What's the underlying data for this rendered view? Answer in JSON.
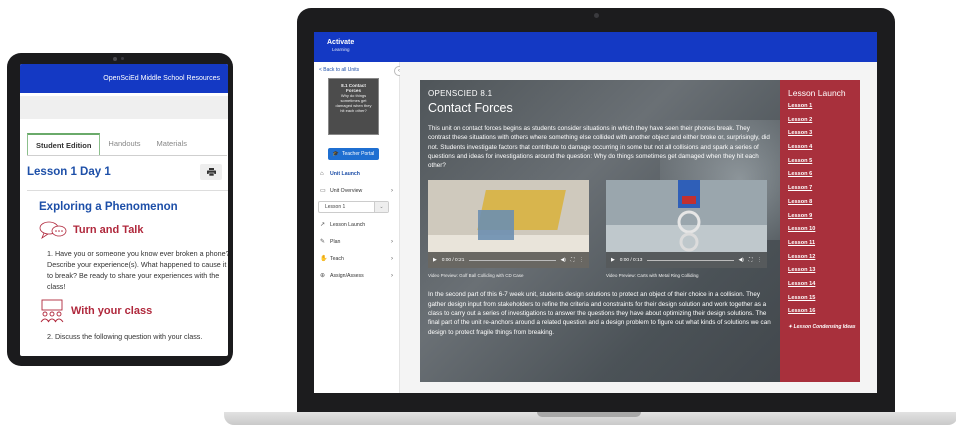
{
  "tablet": {
    "header_title": "OpenSciEd Middle School Resources",
    "tabs": [
      {
        "label": "Student Edition",
        "active": true
      },
      {
        "label": "Handouts",
        "active": false
      },
      {
        "label": "Materials",
        "active": false
      }
    ],
    "lesson_title": "Lesson 1 Day 1",
    "print_icon": "printer-icon",
    "card_title": "Exploring a Phenomenon",
    "turn_and_talk": {
      "title": "Turn and Talk",
      "icon": "speech-bubbles-icon",
      "item": "1. Have you or someone you know ever broken a phone? Describe your experience(s). What happened to cause it to break? Be ready to share your experiences with the class!"
    },
    "with_your_class": {
      "title": "With your class",
      "icon": "class-group-icon",
      "item": "2. Discuss the following question with your class."
    }
  },
  "laptop": {
    "brand": {
      "name": "Activate",
      "sub": "Learning"
    },
    "sidebar": {
      "back_link": "< Back to all Units",
      "thumbnail_text": [
        "8.1 Contact",
        "Forces",
        "Why do things",
        "sometimes get",
        "damaged when they",
        "hit each other?"
      ],
      "teacher_portal": "Teacher Portal",
      "items": [
        {
          "label": "Unit Launch",
          "icon": "home-icon",
          "active": true,
          "chevron": false
        },
        {
          "label": "Unit Overview",
          "icon": "overview-icon",
          "active": false,
          "chevron": true
        }
      ],
      "lesson_select": "Lesson 1",
      "items2": [
        {
          "label": "Lesson Launch",
          "icon": "launch-icon",
          "active": false,
          "chevron": false
        },
        {
          "label": "Plan",
          "icon": "pencil-icon",
          "active": false,
          "chevron": true
        },
        {
          "label": "Teach",
          "icon": "hand-icon",
          "active": false,
          "chevron": true
        },
        {
          "label": "Assign/Assess",
          "icon": "assign-icon",
          "active": false,
          "chevron": true
        }
      ]
    },
    "main": {
      "kicker": "OPENSCIED 8.1",
      "title": "Contact Forces",
      "para1": "This unit on contact forces begins as students consider situations in which they have seen their phones break. They contrast these situations with others where something else collided with another object and either broke or, surprisingly, did not. Students investigate factors that contribute to damage occurring in some but not all collisions and spark a series of questions and ideas for investigations around the question: Why do things sometimes get damaged when they hit each other?",
      "videos": [
        {
          "time": "0:00 / 0:21",
          "caption": "Video Preview: Golf Ball Colliding with CD Case"
        },
        {
          "time": "0:00 / 0:13",
          "caption": "Video Preview: Carts with Metal Ring Colliding"
        }
      ],
      "para2": "In the second part of this 6-7 week unit, students design solutions to protect an object of their choice in a collision. They gather design input from stakeholders to refine the criteria and constraints for their design solution and work together as a class to carry out a series of investigations to answer the questions they have about optimizing their design solutions. The final part of the unit re-anchors around a related question and a design problem to figure out what kinds of solutions we can design to protect fragile things from breaking."
    },
    "lesson_launch": {
      "title": "Lesson Launch",
      "lessons": [
        "Lesson 1",
        "Lesson 2",
        "Lesson 3",
        "Lesson 4",
        "Lesson 5",
        "Lesson 6",
        "Lesson 7",
        "Lesson 8",
        "Lesson 9",
        "Lesson 10",
        "Lesson 11",
        "Lesson 12",
        "Lesson 13",
        "Lesson 14",
        "Lesson 15",
        "Lesson 16"
      ],
      "extra": "Lesson Condensing Ideas"
    }
  }
}
